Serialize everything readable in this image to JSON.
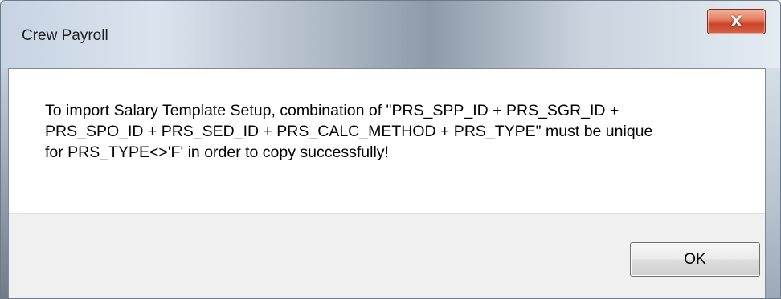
{
  "window": {
    "title": "Crew Payroll"
  },
  "titlebar": {
    "close_label": "X"
  },
  "message": {
    "text": "To import Salary Template Setup, combination of \"PRS_SPP_ID + PRS_SGR_ID +\nPRS_SPO_ID + PRS_SED_ID + PRS_CALC_METHOD + PRS_TYPE\" must be unique\nfor PRS_TYPE<>'F' in order to copy successfully!"
  },
  "buttons": {
    "ok_label": "OK"
  },
  "colors": {
    "close_button": "#c9442a",
    "footer_background": "#f0f0f0",
    "client_background": "#ffffff"
  },
  "icons": {
    "close": "close-icon"
  }
}
